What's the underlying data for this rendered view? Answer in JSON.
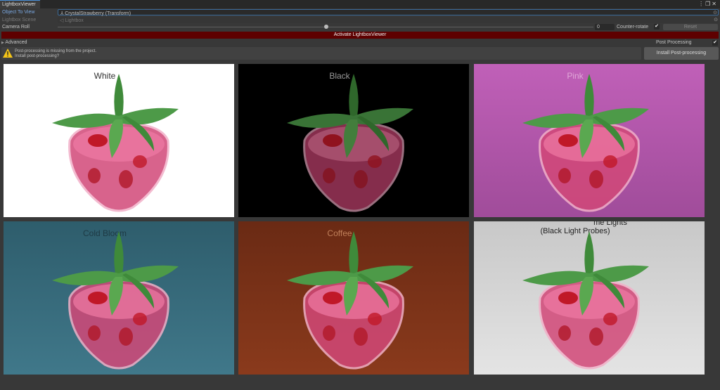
{
  "window": {
    "tab": "LightboxViewer",
    "menu_icon": "kebab-icon",
    "maximize_icon": "maximize-icon",
    "close_icon": "close-icon"
  },
  "fields": {
    "object_to_view": {
      "label": "Object To View",
      "value": "⅄ CrystalStrawberry (Transform)"
    },
    "lightbox_scene": {
      "label": "Lightbox Scene",
      "value": "◁ Lightbox"
    },
    "camera_roll": {
      "label": "Camera Roll",
      "value": "0",
      "slider_fraction": 0.5,
      "counter_rotate_label": "Counter-rotate",
      "counter_rotate_checked": "✔",
      "reset_label": "Reset"
    }
  },
  "activate_label": "Activate LightboxViewer",
  "advanced_label": "Advanced",
  "post_processing": {
    "label": "Post Processing",
    "checked": "✔"
  },
  "warning": {
    "line1": "Post-processing is missing from the project.",
    "line2": "Install post-processing?",
    "install_label": "Install Post-processing"
  },
  "previews": [
    {
      "label": "White",
      "bg": "#ffffff",
      "color": "#333"
    },
    {
      "label": "Black",
      "bg": "#000000",
      "color": "#aaa"
    },
    {
      "label": "Pink",
      "bg": "#b45aa8",
      "color": "#d8a0cc"
    },
    {
      "label": "Cold Bloom",
      "bg": "#3a6a78",
      "color": "#2a4a55"
    },
    {
      "label": "Coffee",
      "bg": "#7a3318",
      "color": "#c0805a"
    },
    {
      "label_line1": "me Lights",
      "label": "(Black Light Probes)",
      "bg": "#d8d8d8",
      "color": "#222"
    }
  ]
}
